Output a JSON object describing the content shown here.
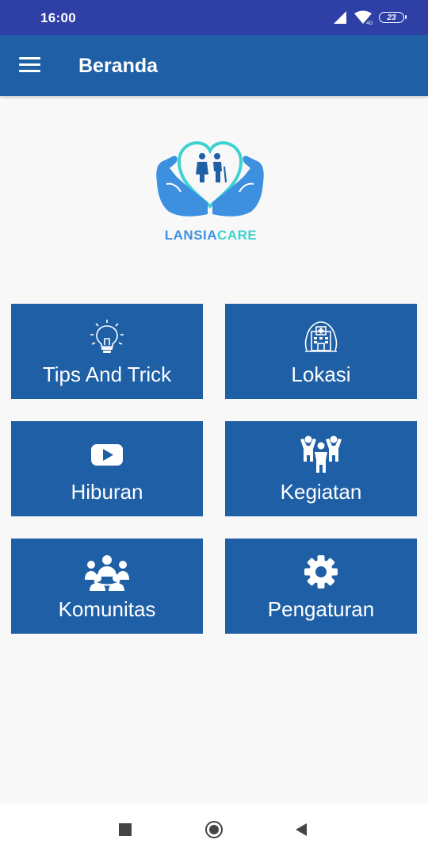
{
  "status_bar": {
    "time": "16:00",
    "battery": "23",
    "icons": [
      "signal-icon",
      "wifi-icon",
      "battery-icon"
    ]
  },
  "app_bar": {
    "title": "Beranda",
    "menu_icon": "hamburger-menu-icon"
  },
  "logo": {
    "text_part1": "LANSIA",
    "text_part2": "CARE"
  },
  "menu": [
    {
      "label": "Tips And Trick",
      "icon": "lightbulb-icon"
    },
    {
      "label": "Lokasi",
      "icon": "hospital-icon"
    },
    {
      "label": "Hiburan",
      "icon": "youtube-icon"
    },
    {
      "label": "Kegiatan",
      "icon": "people-activity-icon"
    },
    {
      "label": "Komunitas",
      "icon": "community-icon"
    },
    {
      "label": "Pengaturan",
      "icon": "gear-icon"
    }
  ],
  "nav_bar": [
    "recents-button",
    "home-button",
    "back-button"
  ],
  "colors": {
    "status_bar": "#2e3fa6",
    "primary": "#1f5fa6",
    "background": "#f8f8f8",
    "logo_blue": "#3d8fe0",
    "logo_teal": "#3ed2d0"
  }
}
